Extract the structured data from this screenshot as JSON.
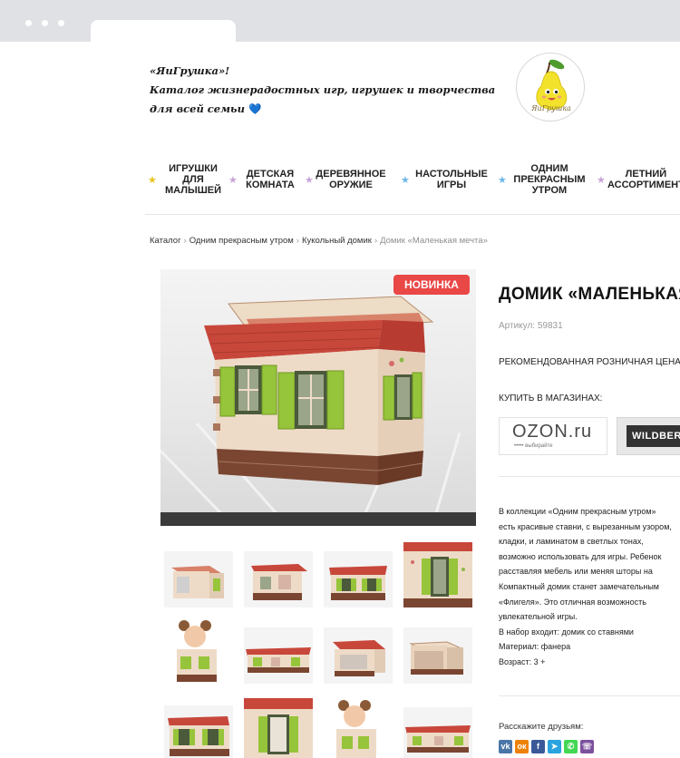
{
  "brand": {
    "line1": "«ЯиГрушка»!",
    "line2": "Каталог жизнерадостных игр, игрушек и творчества",
    "line3": "для всей семьи",
    "heart": "💙",
    "logo_text": "ЯиГрушка"
  },
  "nav": {
    "items": [
      {
        "l1": "Игрушки",
        "l2": "для",
        "l3": "малышей"
      },
      {
        "l1": "Детская",
        "l2": "комната",
        "l3": ""
      },
      {
        "l1": "Деревянное",
        "l2": "оружие",
        "l3": ""
      },
      {
        "l1": "Настольные",
        "l2": "игры",
        "l3": ""
      },
      {
        "l1": "Одним",
        "l2": "прекрасным",
        "l3": "утром"
      },
      {
        "l1": "Летний",
        "l2": "ассортимент",
        "l3": ""
      }
    ],
    "star_colors": [
      "#e8c31c",
      "#c8a3d8",
      "#c8a3d8",
      "#6cb7e8",
      "#6cb7e8",
      "#c8a3d8"
    ],
    "star_glyph": "★"
  },
  "breadcrumb": {
    "items": [
      "Каталог",
      "Одним прекрасным утром",
      "Кукольный домик"
    ],
    "current": "Домик «Маленькая мечта»",
    "separator": "›"
  },
  "product": {
    "badge": "НОВИНКА",
    "title": "ДОМИК «МАЛЕНЬКАЯ МЕЧТА»",
    "sku": "Артикул: 59831",
    "price_label": "РЕКОМЕНДОВАННАЯ РОЗНИЧНАЯ ЦЕНА",
    "buy_label": "КУПИТЬ В МАГАЗИНАХ:",
    "shops": {
      "ozon_logo": "OZON.ru",
      "ozon_tagline": "••••• выбирайте",
      "wb_logo": "WILDBERRIES"
    },
    "description": [
      "В коллекции «Одним прекрасным утром»",
      "есть красивые ставни, с вырезанным узором,",
      "кладки, и ламинатом в светлых тонах,",
      "возможно использовать для игры. Ребенок",
      "расставляя мебель или меняя шторы на",
      "Компактный домик станет замечательным",
      "«Флигеля». Это отличная возможность",
      "увлекательной игры.",
      "В набор входит:  домик со ставнями",
      "Материал: фанера",
      "Возраст: 3 +"
    ]
  },
  "share": {
    "label": "Расскажите друзьям:",
    "buttons": [
      {
        "name": "vk",
        "glyph": "vk",
        "color": "#4a76a8"
      },
      {
        "name": "ok",
        "glyph": "ок",
        "color": "#ee8208"
      },
      {
        "name": "facebook",
        "glyph": "f",
        "color": "#3b5998"
      },
      {
        "name": "telegram",
        "glyph": "➤",
        "color": "#2aa3df"
      },
      {
        "name": "whatsapp",
        "glyph": "✆",
        "color": "#43d854"
      },
      {
        "name": "viber",
        "glyph": "☏",
        "color": "#7b519d"
      }
    ]
  },
  "colors": {
    "roof": "#c8473b",
    "wall": "#eedbc7",
    "shutter": "#96c43a",
    "brick": "#7a4631",
    "badge": "#ea4747"
  }
}
